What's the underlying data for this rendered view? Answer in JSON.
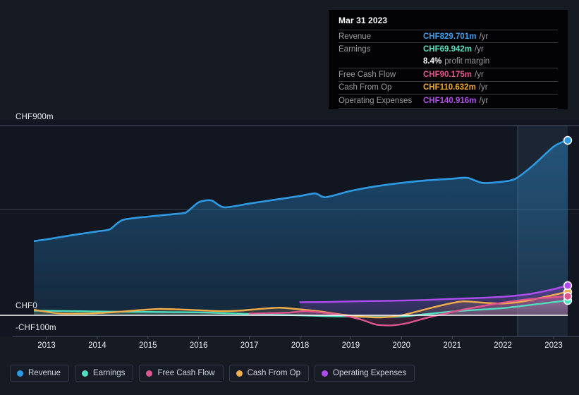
{
  "chart_data": {
    "type": "line",
    "title": "",
    "xlabel": "",
    "ylabel": "",
    "currency": "CHF",
    "units": "m",
    "ylim": [
      -100,
      900
    ],
    "y_ticks": [
      "CHF900m",
      "CHF0",
      "-CHF100m"
    ],
    "y_tick_values": [
      900,
      0,
      -100
    ],
    "grid": true,
    "legend_position": "bottom-left",
    "x": [
      2013,
      2014,
      2015,
      2016,
      2017,
      2018,
      2019,
      2020,
      2021,
      2022,
      2023
    ],
    "categories": [
      "2013",
      "2014",
      "2015",
      "2016",
      "2017",
      "2018",
      "2019",
      "2020",
      "2021",
      "2022",
      "2023"
    ],
    "series": [
      {
        "name": "Revenue",
        "color": "#2f9ae4",
        "start_year": 2012.75,
        "values": [
          352,
          398,
          455,
          536,
          512,
          560,
          600,
          588,
          625,
          648,
          829.701
        ],
        "points": [
          [
            2012.75,
            352
          ],
          [
            2013.0,
            360
          ],
          [
            2013.5,
            380
          ],
          [
            2014.0,
            398
          ],
          [
            2014.25,
            408
          ],
          [
            2014.5,
            452
          ],
          [
            2015.0,
            468
          ],
          [
            2015.5,
            480
          ],
          [
            2015.75,
            488
          ],
          [
            2016.0,
            536
          ],
          [
            2016.25,
            545
          ],
          [
            2016.5,
            512
          ],
          [
            2017.0,
            530
          ],
          [
            2017.5,
            548
          ],
          [
            2018.0,
            566
          ],
          [
            2018.3,
            578
          ],
          [
            2018.5,
            560
          ],
          [
            2019.0,
            590
          ],
          [
            2019.5,
            612
          ],
          [
            2020.0,
            628
          ],
          [
            2020.5,
            640
          ],
          [
            2021.0,
            648
          ],
          [
            2021.3,
            652
          ],
          [
            2021.6,
            628
          ],
          [
            2022.0,
            634
          ],
          [
            2022.25,
            648
          ],
          [
            2022.6,
            712
          ],
          [
            2023.0,
            800
          ],
          [
            2023.25,
            829.701
          ]
        ]
      },
      {
        "name": "Earnings",
        "color": "#4fdec0",
        "start_year": 2012.75,
        "values": [
          22,
          20,
          18,
          15,
          10,
          5,
          0,
          -5,
          12,
          40,
          69.942
        ],
        "points": [
          [
            2012.75,
            22
          ],
          [
            2013.5,
            20
          ],
          [
            2014.0,
            18
          ],
          [
            2014.5,
            17
          ],
          [
            2015.0,
            16
          ],
          [
            2015.5,
            15
          ],
          [
            2016.0,
            14
          ],
          [
            2016.5,
            10
          ],
          [
            2017.0,
            6
          ],
          [
            2017.5,
            2
          ],
          [
            2018.0,
            0
          ],
          [
            2018.5,
            -4
          ],
          [
            2019.0,
            -6
          ],
          [
            2019.5,
            -8
          ],
          [
            2020.0,
            -6
          ],
          [
            2020.5,
            6
          ],
          [
            2021.0,
            18
          ],
          [
            2021.5,
            26
          ],
          [
            2022.0,
            34
          ],
          [
            2022.5,
            48
          ],
          [
            2023.25,
            69.942
          ]
        ]
      },
      {
        "name": "Free Cash Flow",
        "color": "#e05490",
        "start_year": 2017.0,
        "values": [
          null,
          null,
          null,
          null,
          8,
          14,
          2,
          -48,
          20,
          70,
          90.175
        ],
        "points": [
          [
            2017.0,
            8
          ],
          [
            2017.4,
            10
          ],
          [
            2017.8,
            13
          ],
          [
            2018.1,
            20
          ],
          [
            2018.4,
            14
          ],
          [
            2018.8,
            2
          ],
          [
            2019.2,
            -20
          ],
          [
            2019.5,
            -44
          ],
          [
            2019.8,
            -48
          ],
          [
            2020.1,
            -38
          ],
          [
            2020.5,
            -12
          ],
          [
            2021.0,
            16
          ],
          [
            2021.5,
            40
          ],
          [
            2022.0,
            60
          ],
          [
            2022.5,
            76
          ],
          [
            2023.25,
            90.175
          ]
        ]
      },
      {
        "name": "Cash From Op",
        "color": "#efae4a",
        "start_year": 2012.75,
        "values": [
          26,
          8,
          16,
          26,
          20,
          14,
          -4,
          -12,
          50,
          72,
          110.632
        ],
        "points": [
          [
            2012.75,
            26
          ],
          [
            2013.2,
            10
          ],
          [
            2013.6,
            8
          ],
          [
            2014.0,
            10
          ],
          [
            2014.4,
            16
          ],
          [
            2014.8,
            24
          ],
          [
            2015.2,
            30
          ],
          [
            2015.6,
            28
          ],
          [
            2016.0,
            24
          ],
          [
            2016.4,
            20
          ],
          [
            2016.8,
            22
          ],
          [
            2017.2,
            30
          ],
          [
            2017.6,
            36
          ],
          [
            2018.0,
            28
          ],
          [
            2018.4,
            18
          ],
          [
            2018.8,
            4
          ],
          [
            2019.2,
            -6
          ],
          [
            2019.6,
            -10
          ],
          [
            2020.0,
            0
          ],
          [
            2020.4,
            24
          ],
          [
            2020.8,
            48
          ],
          [
            2021.2,
            66
          ],
          [
            2021.6,
            60
          ],
          [
            2022.0,
            56
          ],
          [
            2022.4,
            66
          ],
          [
            2022.8,
            86
          ],
          [
            2023.25,
            110.632
          ]
        ]
      },
      {
        "name": "Operating Expenses",
        "color": "#b04df0",
        "start_year": 2018.0,
        "values": [
          null,
          null,
          null,
          null,
          null,
          62,
          66,
          70,
          78,
          96,
          140.916
        ],
        "points": [
          [
            2018.0,
            62
          ],
          [
            2018.5,
            63
          ],
          [
            2019.0,
            66
          ],
          [
            2019.5,
            68
          ],
          [
            2020.0,
            70
          ],
          [
            2020.5,
            73
          ],
          [
            2021.0,
            78
          ],
          [
            2021.5,
            82
          ],
          [
            2022.0,
            88
          ],
          [
            2022.5,
            100
          ],
          [
            2023.0,
            124
          ],
          [
            2023.25,
            140.916
          ]
        ]
      }
    ]
  },
  "tooltip": {
    "title": "Mar 31 2023",
    "rows": [
      {
        "key": "Revenue",
        "value": "CHF829.701m",
        "unit": "/yr",
        "color": "#3d9de8"
      },
      {
        "key": "Earnings",
        "value": "CHF69.942m",
        "unit": "/yr",
        "color": "#5ae0c0"
      },
      {
        "key": "",
        "value": "8.4%",
        "unit": "profit margin",
        "color": "#ffffff",
        "margin_row": true
      },
      {
        "key": "Free Cash Flow",
        "value": "CHF90.175m",
        "unit": "/yr",
        "color": "#e8538f"
      },
      {
        "key": "Cash From Op",
        "value": "CHF110.632m",
        "unit": "/yr",
        "color": "#f0a830"
      },
      {
        "key": "Operating Expenses",
        "value": "CHF140.916m",
        "unit": "/yr",
        "color": "#b44df0"
      }
    ]
  },
  "axes": {
    "y_top_label": "CHF900m",
    "y_zero_label": "CHF0",
    "y_bottom_label": "-CHF100m",
    "x_labels": [
      "2013",
      "2014",
      "2015",
      "2016",
      "2017",
      "2018",
      "2019",
      "2020",
      "2021",
      "2022",
      "2023"
    ]
  },
  "legend": {
    "items": [
      {
        "label": "Revenue",
        "color": "#2f9ae4"
      },
      {
        "label": "Earnings",
        "color": "#4fdec0"
      },
      {
        "label": "Free Cash Flow",
        "color": "#e05490"
      },
      {
        "label": "Cash From Op",
        "color": "#efae4a"
      },
      {
        "label": "Operating Expenses",
        "color": "#b04df0"
      }
    ]
  },
  "colors": {
    "background": "#151a23",
    "plot_background": "#111621",
    "zero_line": "#ffffff",
    "grid": "#3a4252",
    "tooltip_background": "#030305",
    "highlight_band": "#1b2634"
  }
}
